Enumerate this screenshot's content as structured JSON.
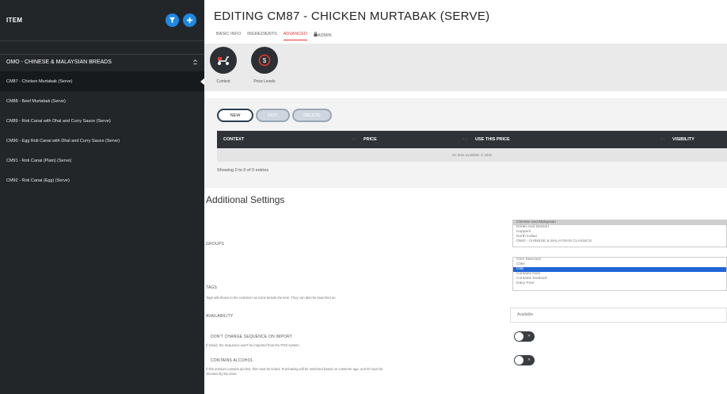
{
  "sidebar": {
    "title": "ITEM",
    "group": "OMO - CHINESE & MALAYSIAN BREADS",
    "items": [
      {
        "label": "CM87 - Chicken Murtabak (Serve)"
      },
      {
        "label": "CM88 - Beef Murtabak (Serve)"
      },
      {
        "label": "CM89 - Roti Canai with Dhal and Curry Sauce (Serve)"
      },
      {
        "label": "CM90 - Egg Roti Canai with Dhal and Curry Sauce (Serve)"
      },
      {
        "label": "CM91 - Roti Canai (Plain) (Serve)"
      },
      {
        "label": "CM92 - Roti Canai (Egg) (Serve)"
      }
    ],
    "active_index": 0
  },
  "header": {
    "title": "EDITING CM87 - CHICKEN MURTABAK (SERVE)",
    "tabs": [
      "BASIC INFO",
      "INGREDIENTS",
      "ADVANCED",
      "ADMIN"
    ],
    "active_tab": "ADVANCED"
  },
  "context_buttons": [
    {
      "label": "Context",
      "icon": "scooter-icon"
    },
    {
      "label": "Price Levels",
      "icon": "dollar-icon"
    }
  ],
  "table": {
    "buttons": [
      "NEW",
      "EDIT",
      "DELETE"
    ],
    "columns": [
      "CONTEXT",
      "PRICE",
      "USE THIS PRICE",
      "VISIBILITY"
    ],
    "empty_text": "No data available in table",
    "info": "Showing 0 to 0 of 0 entries"
  },
  "settings": {
    "title": "Additional Settings",
    "groups": {
      "label": "GROUPS",
      "options": [
        "Chinese and Malaysian",
        "Drinks And Dessert",
        "Hoppers",
        "North Indian",
        "OMO - CHINESE & MALAYSIAN CLASSICS"
      ],
      "highlighted": "Chinese and Malaysian"
    },
    "tags": {
      "label": "TAGS",
      "help": "Tags will shown to the customer as icons beside the item. They can also be searched on.",
      "options": [
        "Chef Selection",
        "Chile",
        "Chili",
        "Contains Nuts",
        "Contains Seafood",
        "Dairy Free"
      ],
      "selected": "Chili"
    },
    "availability": {
      "label": "AVAILABILITY",
      "value": "Available"
    },
    "sequence": {
      "label": "DON'T CHANGE SEQUENCE ON IMPORT",
      "help": "If ticked, the Sequence won't be imported from the POS system.",
      "enabled": false
    },
    "alcohol": {
      "label": "CONTAINS ALCOHOL",
      "help_line1": "If this product contains alcohol, this must be ticked. Purchasing will be restricted based on customer age, and ID must be",
      "help_line2": "checked by the store.",
      "enabled": false
    }
  },
  "colors": {
    "sidebar_bg": "#232629",
    "accent_blue": "#1e88e5",
    "tab_active": "#e53935",
    "table_header": "#2f3237"
  }
}
